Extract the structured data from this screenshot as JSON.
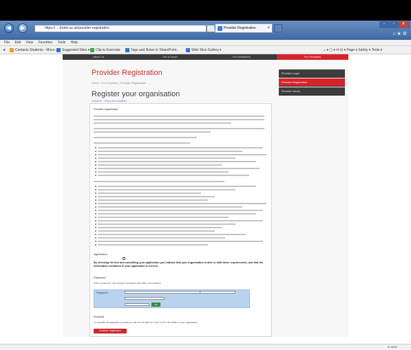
{
  "browser": {
    "address": "https://... .footer.ac.uk/provider-registration",
    "address_icons": "Ρ ▾ ⊠ C",
    "tab_title": "Provider Registration",
    "menu": [
      "File",
      "Edit",
      "View",
      "Favorites",
      "Tools",
      "Help"
    ],
    "favorites": [
      {
        "label": "Contacts Students - Micro...",
        "color": "#e8a020"
      },
      {
        "label": "Suggested Sites ▾",
        "color": "#3a6fd0"
      },
      {
        "label": "Clip to Evernote",
        "color": "#4aa04a"
      },
      {
        "label": "Tags and Notes in SharePoint...",
        "color": "#3a6fd0"
      },
      {
        "label": "Web Slice Gallery ▾",
        "color": "#3a6fd0"
      }
    ],
    "command_bar": "⌂ ▾ ▢ ▾ ✉ ⊟ ▾ Page ▾  Safety ▾  Tools ▾",
    "zoom": "⚲ 100%"
  },
  "site_nav": [
    {
      "label": "About us",
      "active": false
    },
    {
      "label": "Get in touch",
      "active": false
    },
    {
      "label": "For Volunteers",
      "active": false
    },
    {
      "label": "For Providers",
      "active": true
    }
  ],
  "page": {
    "title": "Provider Registration",
    "breadcrumb": "Home › For Providers › Provider Registration",
    "heading": "Register your organisation",
    "sub_links": "Guidance · Terms and conditions",
    "section_agreement": "Provider Agreement",
    "agreement_heading": "Agreement",
    "agreement_text": "By checking the box and submitting your application you indicate that your organisation is able to fulfil these requirements, and that the information contained in your application is correct.",
    "password_heading": "Password",
    "password_intro": "Enter a password. Use at least 8 characters with letters and numbers.",
    "password_label": "Password",
    "password_btn": "OK",
    "finish_heading": "Finished",
    "finish_text": "To complete the application process you will now be taken to a form to fill in the details of your organisation.",
    "submit_label": "Continue registration"
  },
  "sidebar": [
    {
      "label": "Provider Login",
      "active": false
    },
    {
      "label": "Provider Registration",
      "active": true
    },
    {
      "label": "Provider Terms",
      "active": false
    }
  ]
}
